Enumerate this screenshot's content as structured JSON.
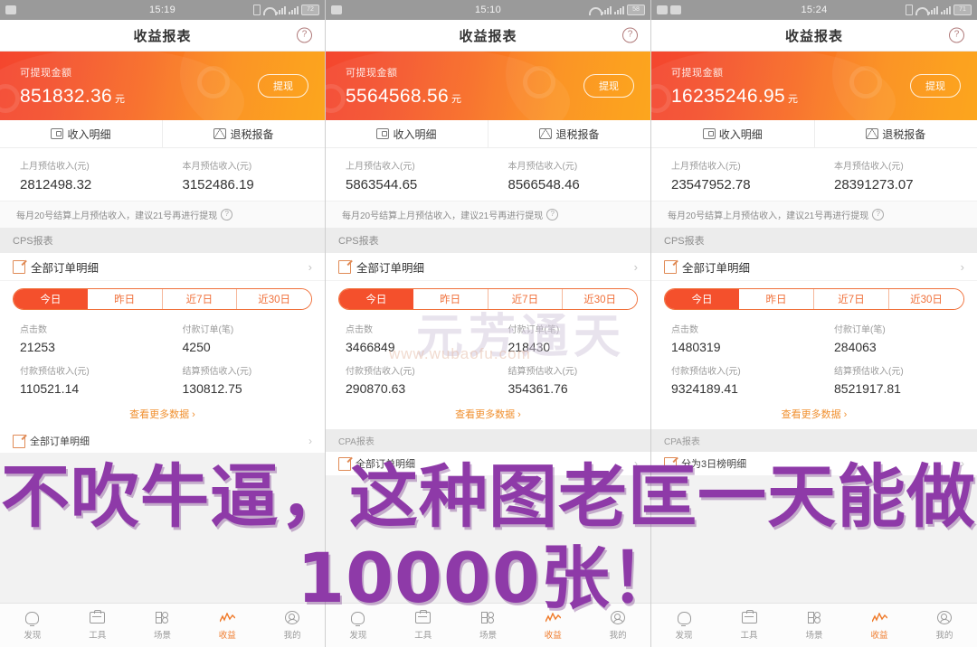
{
  "app": {
    "title": "收益报表",
    "help_icon": "?",
    "banner_label": "可提现金额",
    "yuan_unit": "元",
    "withdraw_label": "提现",
    "entry_income": "收入明细",
    "entry_tax": "退税报备",
    "est_last_month_label": "上月预估收入(元)",
    "est_this_month_label": "本月预估收入(元)",
    "hint_text": "每月20号结算上月预估收入，建议21号再进行提现",
    "hint_icon": "?",
    "cps_section": "CPS报表",
    "cpa_section": "CPA报表",
    "all_orders_label": "全部订单明细",
    "chevron": "›",
    "tabs": [
      "今日",
      "昨日",
      "近7日",
      "近30日"
    ],
    "active_tab_index": 0,
    "stat_clicks_label": "点击数",
    "stat_paid_orders_label": "付款订单(笔)",
    "stat_paid_income_label": "付款预估收入(元)",
    "stat_settle_income_label": "结算预估收入(元)",
    "more_label": "查看更多数据 ›",
    "lower_row1_label": "全部订单明细",
    "lower_row2_label": "分为3日榜明细",
    "accent_orange": "#f4502c",
    "accent_gold": "#fca211",
    "overlay_purple": "#8e3aa8"
  },
  "panels": [
    {
      "status": {
        "time": "15:19",
        "battery": "72"
      },
      "balance": "851832.36",
      "est_last_month": "2812498.32",
      "est_this_month": "3152486.19",
      "clicks": "21253",
      "paid_orders": "4250",
      "paid_income": "110521.14",
      "settle_income": "130812.75"
    },
    {
      "status": {
        "time": "15:10",
        "battery": "58"
      },
      "balance": "5564568.56",
      "est_last_month": "5863544.65",
      "est_this_month": "8566548.46",
      "clicks": "3466849",
      "paid_orders": "218430",
      "paid_income": "290870.63",
      "settle_income": "354361.76"
    },
    {
      "status": {
        "time": "15:24",
        "battery": "71"
      },
      "balance": "16235246.95",
      "est_last_month": "23547952.78",
      "est_this_month": "28391273.07",
      "clicks": "1480319",
      "paid_orders": "284063",
      "paid_income": "9324189.41",
      "settle_income": "8521917.81"
    }
  ],
  "bottom_nav": {
    "items": [
      {
        "label": "发现",
        "icon": "bulb-icon",
        "active": false
      },
      {
        "label": "工具",
        "icon": "briefcase-icon",
        "active": false
      },
      {
        "label": "场景",
        "icon": "grid-icon",
        "active": false
      },
      {
        "label": "收益",
        "icon": "chart-icon",
        "active": true
      },
      {
        "label": "我的",
        "icon": "user-icon",
        "active": false
      }
    ]
  },
  "watermark": {
    "logo": "元芳通天",
    "url": "www.wubaofu.com",
    "overlay_line1": "不吹牛逼，这种图老匡一天能做",
    "overlay_line2": "10000张！"
  }
}
